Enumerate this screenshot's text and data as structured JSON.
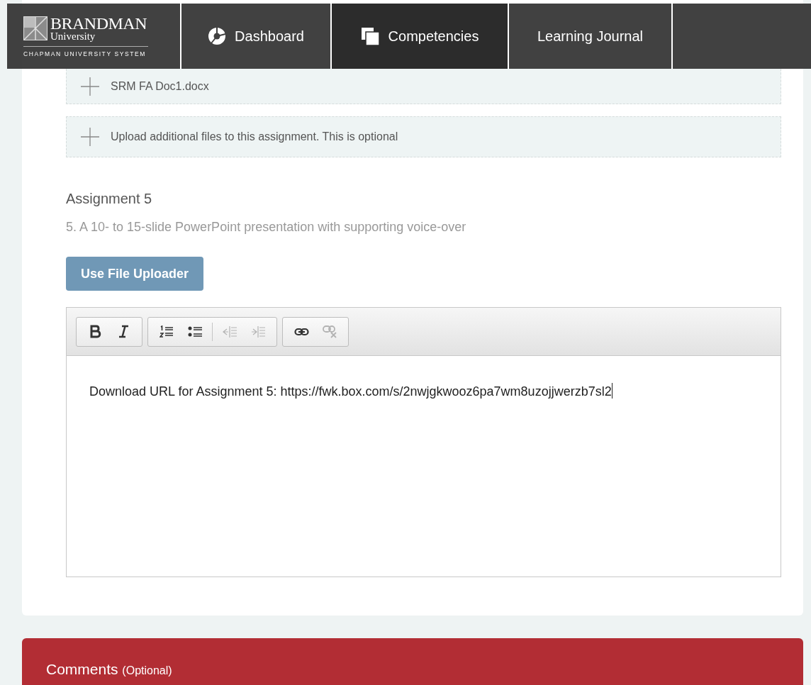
{
  "logo": {
    "name": "BRANDMAN",
    "sub": "University",
    "system": "CHAPMAN UNIVERSITY SYSTEM"
  },
  "nav": [
    {
      "label": "Dashboard",
      "kind": "dashboard",
      "selected": false
    },
    {
      "label": "Competencies",
      "kind": "competencies",
      "selected": true
    },
    {
      "label": "Learning Journal",
      "kind": "plain",
      "selected": false
    }
  ],
  "files": [
    {
      "label": "SRM FA Doc1.docx"
    },
    {
      "label": "Upload additional files to this assignment. This is optional"
    }
  ],
  "assignment": {
    "title": "Assignment 5",
    "description": "5. A 10- to 15-slide PowerPoint presentation with supporting voice-over",
    "button": "Use File Uploader"
  },
  "editor": {
    "toolbar": [
      [
        {
          "kind": "bold",
          "disabled": false
        },
        {
          "kind": "italic",
          "disabled": false
        }
      ],
      [
        {
          "kind": "numbered-list",
          "disabled": false
        },
        {
          "kind": "bulleted-list",
          "disabled": false
        },
        {
          "kind": "outdent",
          "disabled": true
        },
        {
          "kind": "indent",
          "disabled": true
        }
      ],
      [
        {
          "kind": "link",
          "disabled": false
        },
        {
          "kind": "unlink",
          "disabled": true
        }
      ]
    ],
    "value": "Download URL for Assignment 5: https://fwk.box.com/s/2nwjgkwooz6pa7wm8uzojjwerzb7sl2"
  },
  "comments": {
    "title": "Comments",
    "note": "(Optional)"
  }
}
